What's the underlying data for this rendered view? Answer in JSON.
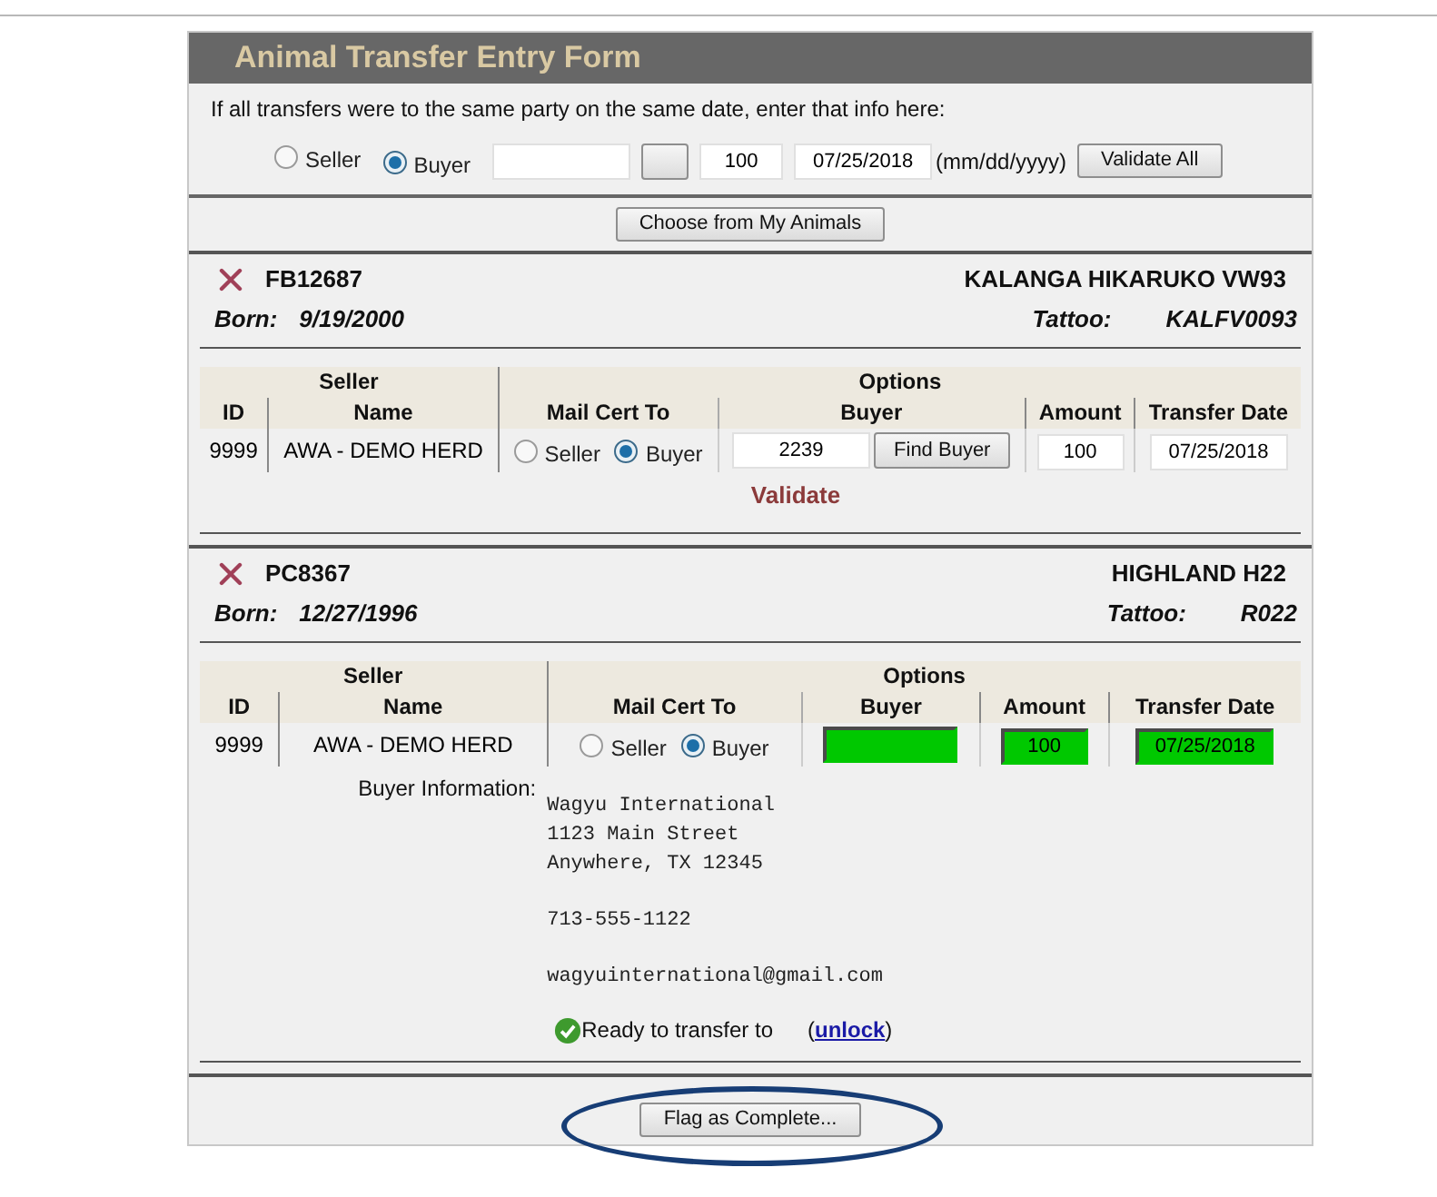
{
  "form": {
    "title": "Animal Transfer Entry Form",
    "instructions": "If all transfers were to the same party on the same date, enter that info here:",
    "mail_options": [
      {
        "label": "Seller",
        "selected": false
      },
      {
        "label": "Buyer",
        "selected": true
      }
    ],
    "amount": "100",
    "date": "07/25/2018",
    "date_hint": "(mm/dd/yyyy)",
    "validate_all": "Validate All",
    "choose_button": "Choose from My Animals"
  },
  "animals": [
    {
      "id": "FB12687",
      "name": "KALANGA HIKARUKO VW93",
      "born_label": "Born:",
      "born": "9/19/2000",
      "tattoo_label": "Tattoo:",
      "tattoo": "KALFV0093",
      "group_headers": [
        "Seller",
        "Options"
      ],
      "columns": [
        "ID",
        "Name",
        "Mail Cert To",
        "Buyer",
        "Amount",
        "Transfer Date"
      ],
      "seller_id": "9999",
      "seller_name": "AWA - DEMO HERD",
      "mail_options": [
        {
          "label": "Seller",
          "selected": false
        },
        {
          "label": "Buyer",
          "selected": true
        }
      ],
      "buyer": "2239",
      "find_button": "Find Buyer",
      "amount": "100",
      "transfer_date": "07/25/2018",
      "validated": false,
      "validate_link": "Validate"
    },
    {
      "id": "PC8367",
      "name": "HIGHLAND H22",
      "born_label": "Born:",
      "born": "12/27/1996",
      "tattoo_label": "Tattoo:",
      "tattoo": "R022",
      "group_headers": [
        "Seller",
        "Options"
      ],
      "columns": [
        "ID",
        "Name",
        "Mail Cert To",
        "Buyer",
        "Amount",
        "Transfer Date"
      ],
      "seller_id": "9999",
      "seller_name": "AWA - DEMO HERD",
      "mail_options": [
        {
          "label": "Seller",
          "selected": false
        },
        {
          "label": "Buyer",
          "selected": true
        }
      ],
      "amount": "100",
      "transfer_date": "07/25/2018",
      "validated": true,
      "buyer_info": {
        "label": "Buyer Information:",
        "address": [
          "Wagyu International",
          "1123 Main Street",
          "Anywhere, TX 12345"
        ],
        "phone": "713-555-1122",
        "email": "wagyuinternational@gmail.com",
        "status": "Ready to transfer to",
        "unlock_open": "(",
        "unlock": "unlock",
        "unlock_close": ")"
      }
    }
  ],
  "footer_button": "Flag as Complete..."
}
